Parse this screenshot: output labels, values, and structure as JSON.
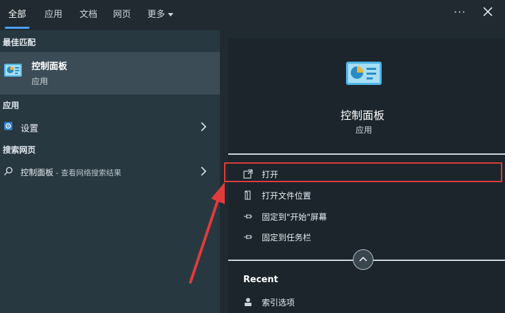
{
  "tabs": [
    "全部",
    "应用",
    "文档",
    "网页",
    "更多"
  ],
  "menu_more_icon": "more-dots-icon",
  "left": {
    "best_match_header": "最佳匹配",
    "best_match": {
      "title": "控制面板",
      "subtitle": "应用"
    },
    "apps_header": "应用",
    "apps": [
      {
        "label": "设置"
      }
    ],
    "web_header": "搜索网页",
    "web_result": {
      "query": "控制面板",
      "suffix": " - 查看网络搜索结果"
    }
  },
  "right": {
    "app_title": "控制面板",
    "app_subtitle": "应用",
    "actions": [
      "打开",
      "打开文件位置",
      "固定到\"开始\"屏幕",
      "固定到任务栏"
    ],
    "recent_header": "Recent",
    "recent_items": [
      "索引选项"
    ]
  },
  "colors": {
    "accent": "#4aa3ff",
    "highlight_border": "#e23b3b",
    "annotation_arrow": "#e23b3b"
  }
}
